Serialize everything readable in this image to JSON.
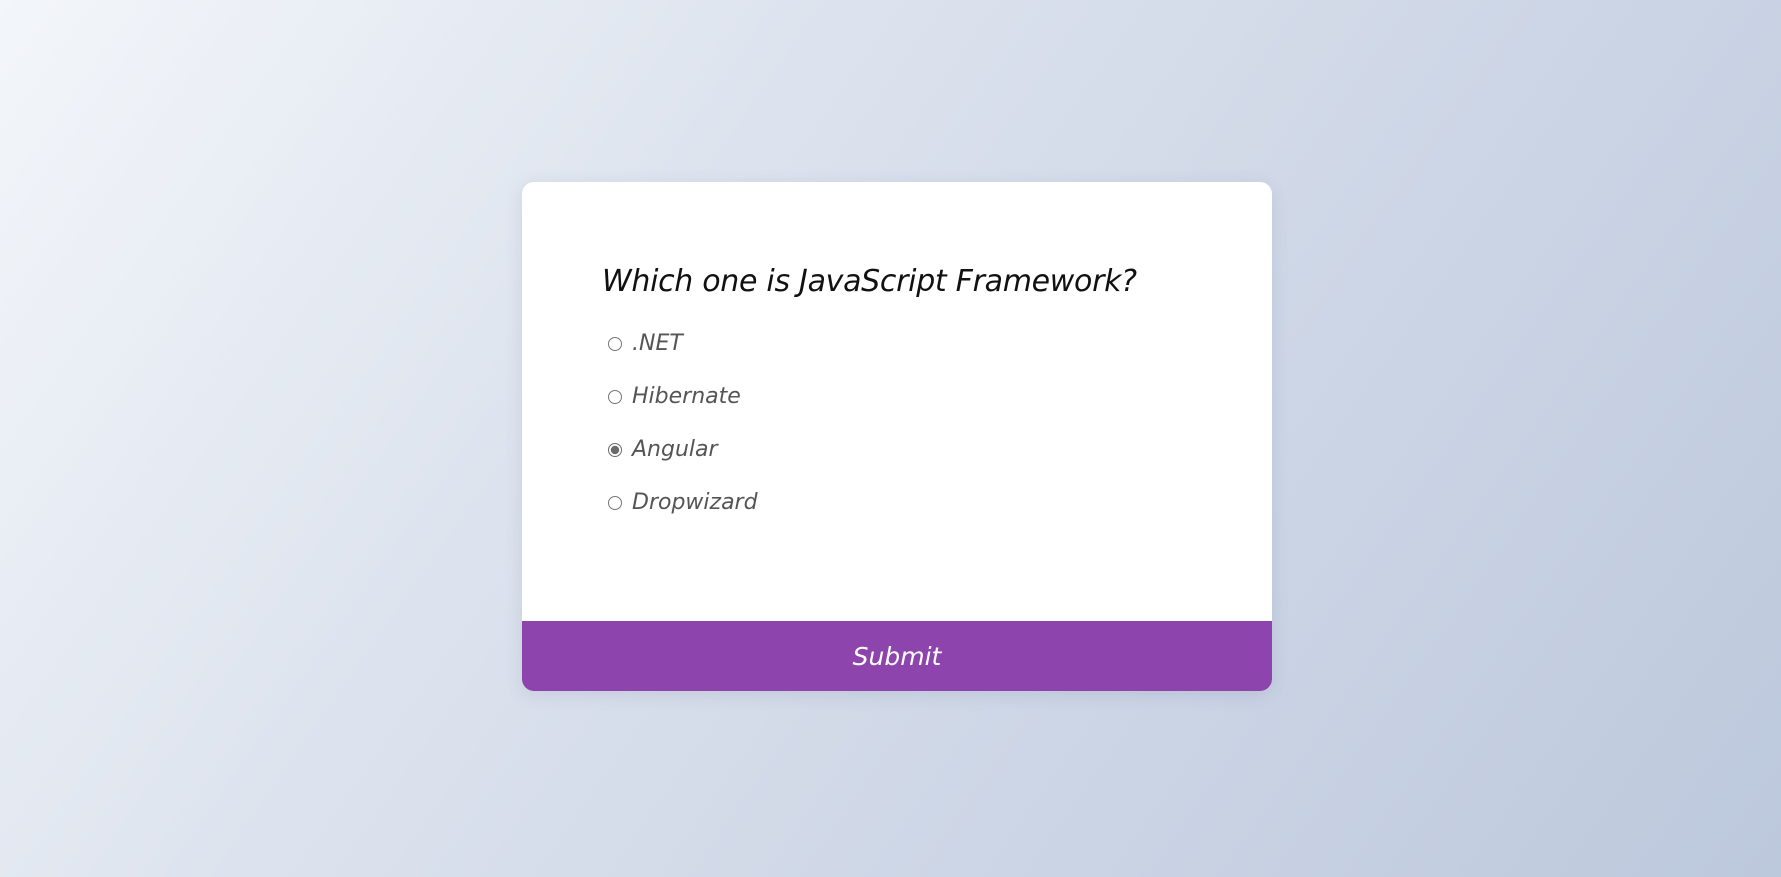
{
  "quiz": {
    "question": "Which one is JavaScript Framework?",
    "options": [
      {
        "label": ".NET",
        "checked": false
      },
      {
        "label": "Hibernate",
        "checked": false
      },
      {
        "label": "Angular",
        "checked": true
      },
      {
        "label": "Dropwizard",
        "checked": false
      }
    ],
    "submit_label": "Submit"
  },
  "colors": {
    "accent": "#8e44ad",
    "card_background": "#ffffff",
    "question_text": "#111111",
    "option_text": "#555555"
  }
}
